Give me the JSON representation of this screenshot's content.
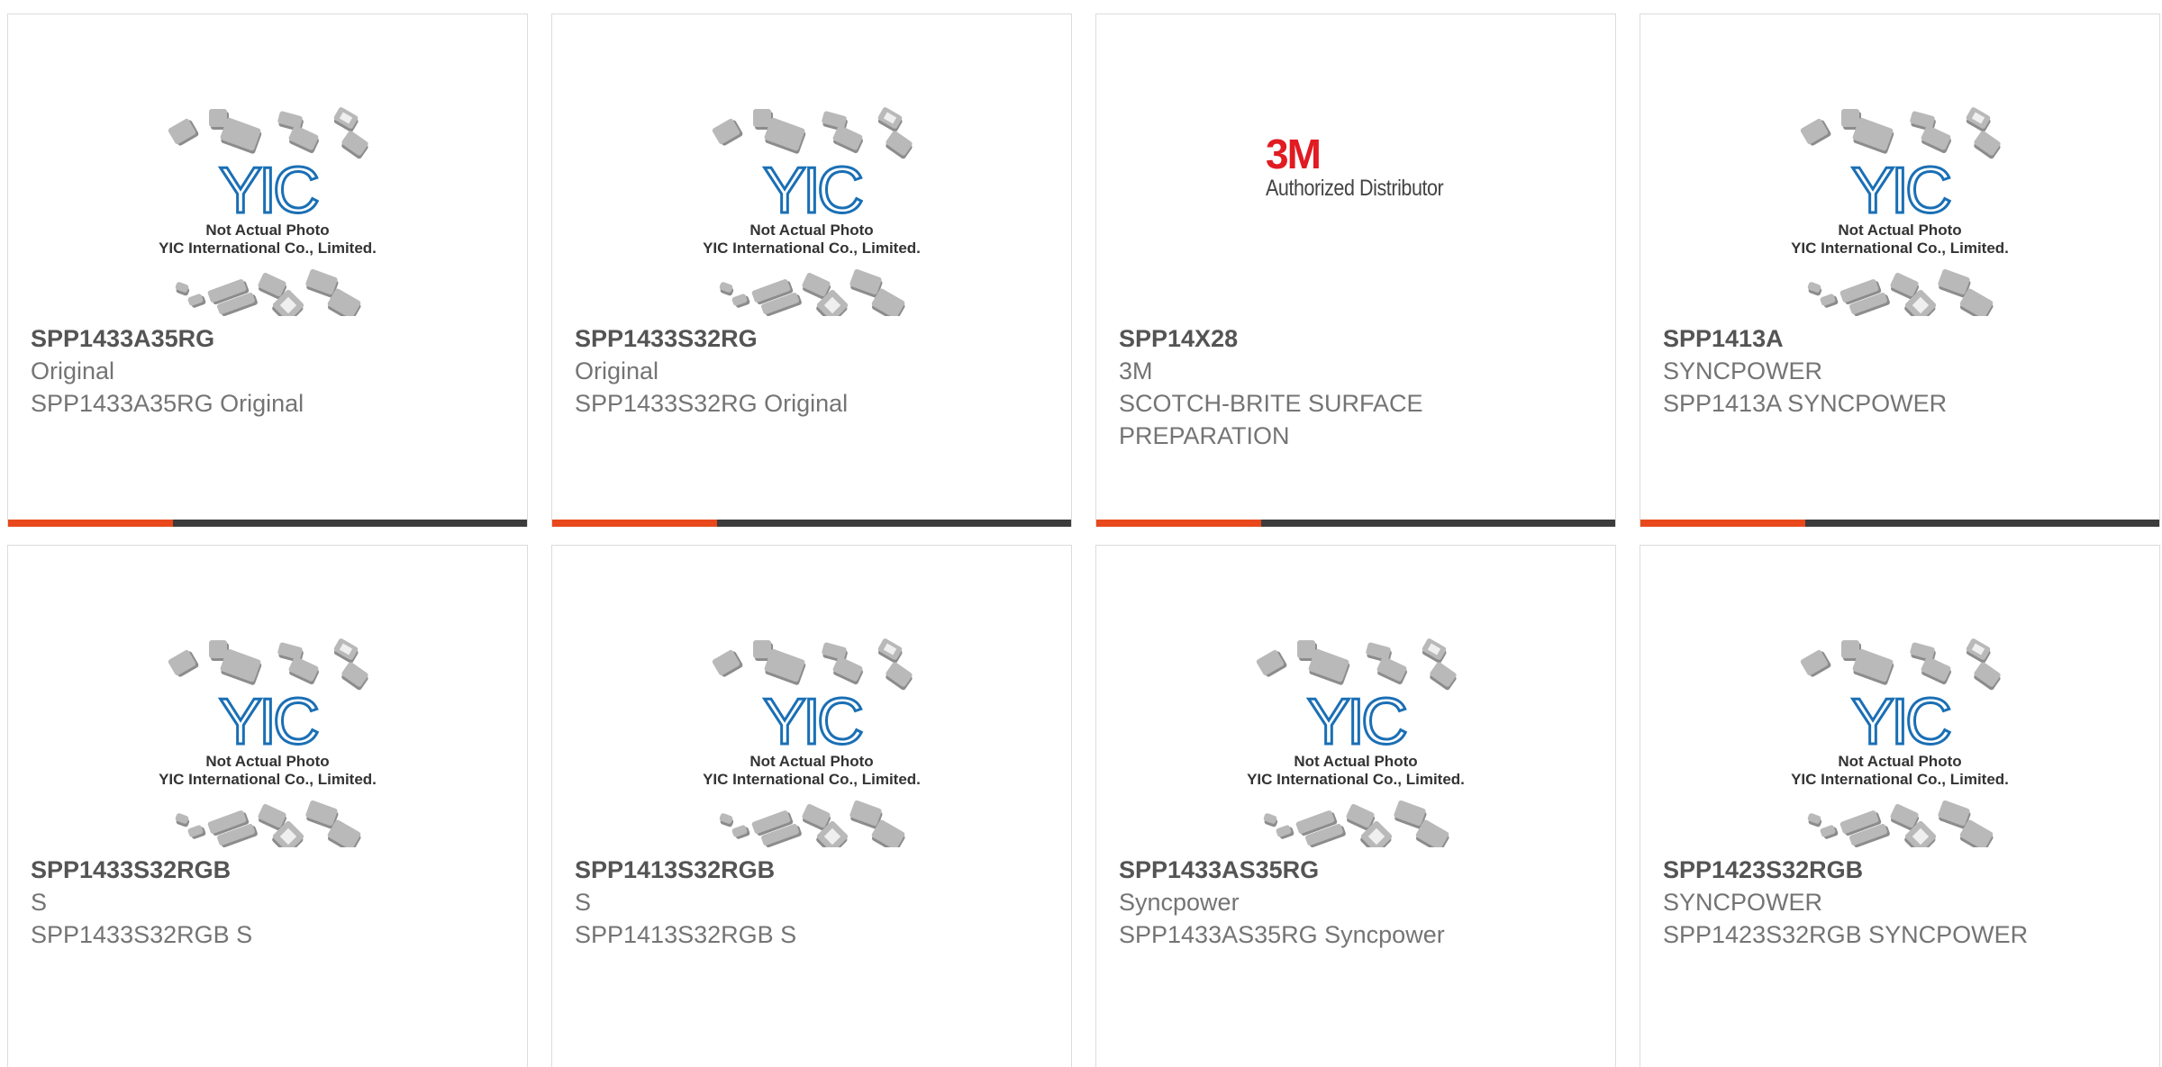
{
  "products": [
    {
      "part": "SPP1433A35RG",
      "mfr": "Original",
      "desc": "SPP1433A35RG Original",
      "image": "placeholder"
    },
    {
      "part": "SPP1433S32RG",
      "mfr": "Original",
      "desc": "SPP1433S32RG Original",
      "image": "placeholder"
    },
    {
      "part": "SPP14X28",
      "mfr": "3M",
      "desc": "SCOTCH-BRITE SURFACE PREPARATION",
      "image": "3m-logo"
    },
    {
      "part": "SPP1413A",
      "mfr": "SYNCPOWER",
      "desc": "SPP1413A SYNCPOWER",
      "image": "placeholder"
    },
    {
      "part": "SPP1433S32RGB",
      "mfr": "S",
      "desc": "SPP1433S32RGB S",
      "image": "placeholder"
    },
    {
      "part": "SPP1413S32RGB",
      "mfr": "S",
      "desc": "SPP1413S32RGB S",
      "image": "placeholder"
    },
    {
      "part": "SPP1433AS35RG",
      "mfr": "Syncpower",
      "desc": "SPP1433AS35RG Syncpower",
      "image": "placeholder"
    },
    {
      "part": "SPP1423S32RGB",
      "mfr": "SYNCPOWER",
      "desc": "SPP1423S32RGB SYNCPOWER",
      "image": "placeholder"
    }
  ],
  "placeholder": {
    "logo_text": "YIC",
    "caption_line1": "Not Actual Photo",
    "caption_line2": "YIC International Co., Limited."
  },
  "logo_3m": {
    "brand": "3M",
    "tagline": "Authorized Distributor"
  },
  "colors": {
    "accent": "#e8481c",
    "bar_dark": "#3c3c3c",
    "brand_3m_red": "#e11b22",
    "yic_blue": "#1a6fb5"
  }
}
